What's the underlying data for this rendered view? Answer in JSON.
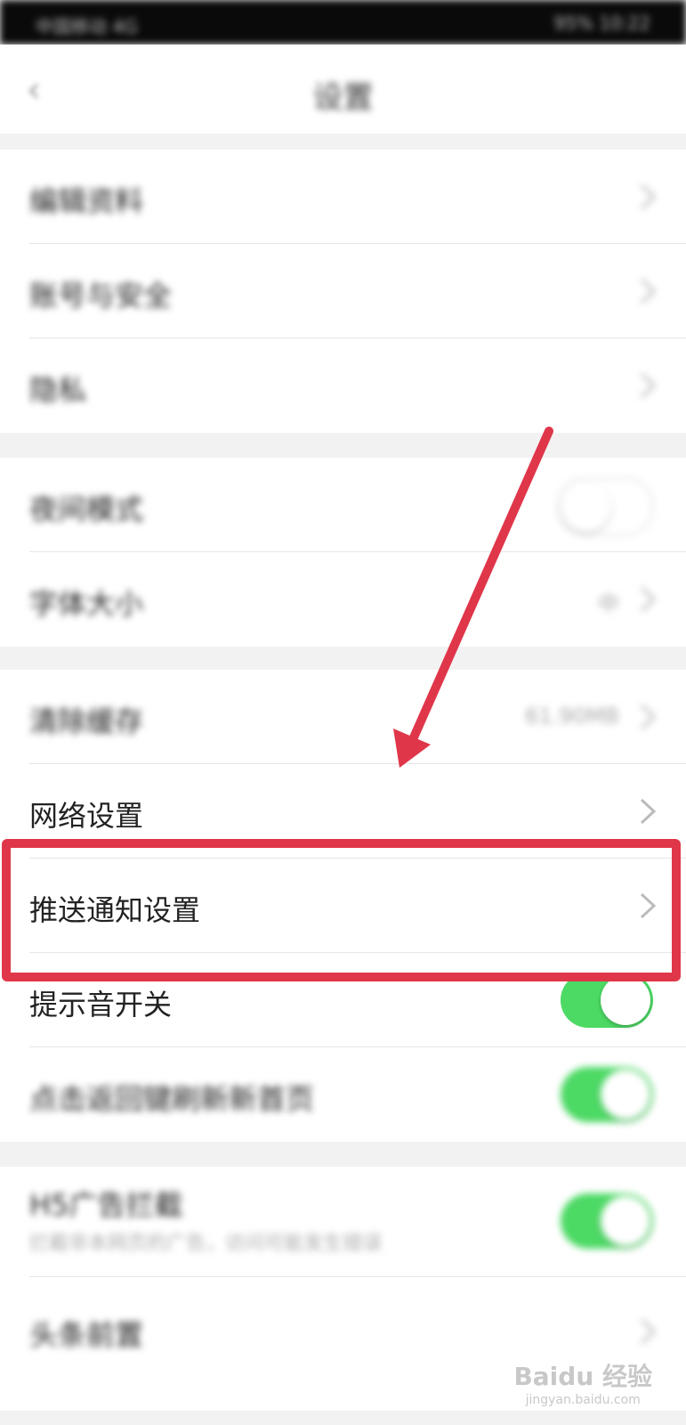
{
  "statusbar": {
    "left_text": "中国移动 4G",
    "right_text": "95% 10:22"
  },
  "navbar": {
    "back_icon": "chevron-left-icon",
    "title": "设置"
  },
  "group1": [
    {
      "label": "编辑资料"
    },
    {
      "label": "账号与安全"
    },
    {
      "label": "隐私"
    }
  ],
  "group2": [
    {
      "label": "夜间模式",
      "toggle": false
    },
    {
      "label": "字体大小",
      "value": "中"
    }
  ],
  "group3": [
    {
      "label": "清除缓存",
      "value": "61.90MB"
    },
    {
      "label": "网络设置"
    },
    {
      "label": "推送通知设置"
    },
    {
      "label": "提示音开关",
      "toggle": true
    },
    {
      "label": "点击返回键刷新新首页",
      "toggle": true
    }
  ],
  "group4": [
    {
      "label": "H5广告拦截",
      "sub": "拦截非本网页的广告，访问可能发生错误",
      "toggle": true
    },
    {
      "label": "头条前置"
    }
  ],
  "annotation": {
    "highlight_color": "#e0364a",
    "arrow_color": "#e0364a"
  },
  "colors": {
    "toggle_on": "#4cd964"
  },
  "watermark": {
    "brand": "Baidu 经验",
    "url": "jingyan.baidu.com"
  }
}
